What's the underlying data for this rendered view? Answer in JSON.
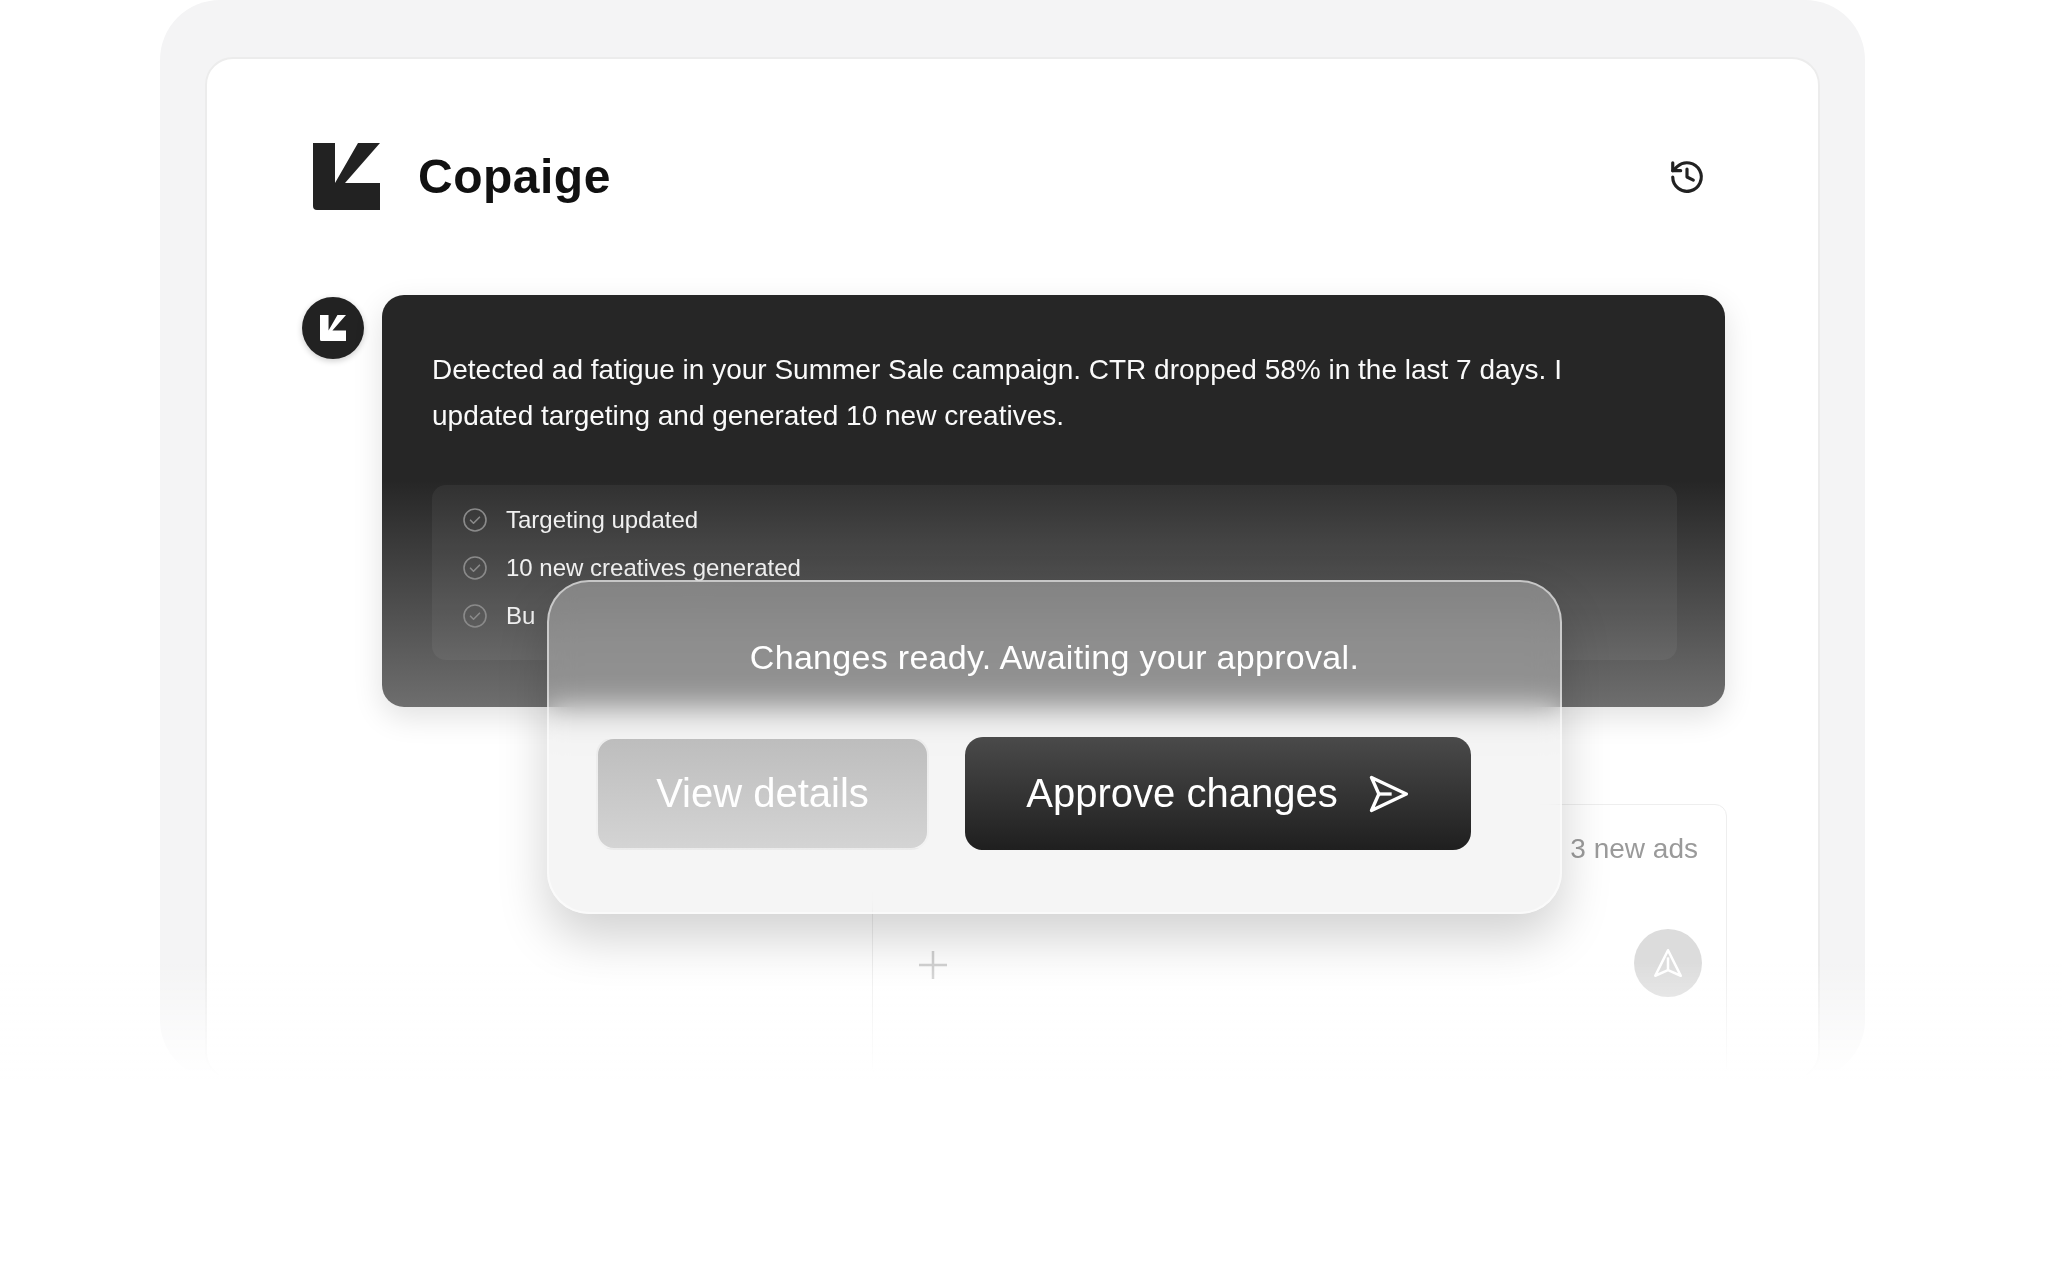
{
  "app": {
    "name": "Copaige"
  },
  "message": {
    "text": "Detected ad fatigue in your Summer Sale campaign. CTR dropped 58% in the last 7 days. I updated targeting and generated 10 new creatives.",
    "tasks": [
      {
        "label": "Targeting updated",
        "done": true
      },
      {
        "label": "10 new creatives generated",
        "done": true
      },
      {
        "label": "Bu",
        "done": true
      }
    ]
  },
  "approval": {
    "title": "Changes ready. Awaiting your approval.",
    "buttons": [
      {
        "label": "View details",
        "kind": "secondary"
      },
      {
        "label": "Approve changes",
        "kind": "primary"
      }
    ]
  },
  "composer": {
    "text_fragment": "3 new ads"
  }
}
